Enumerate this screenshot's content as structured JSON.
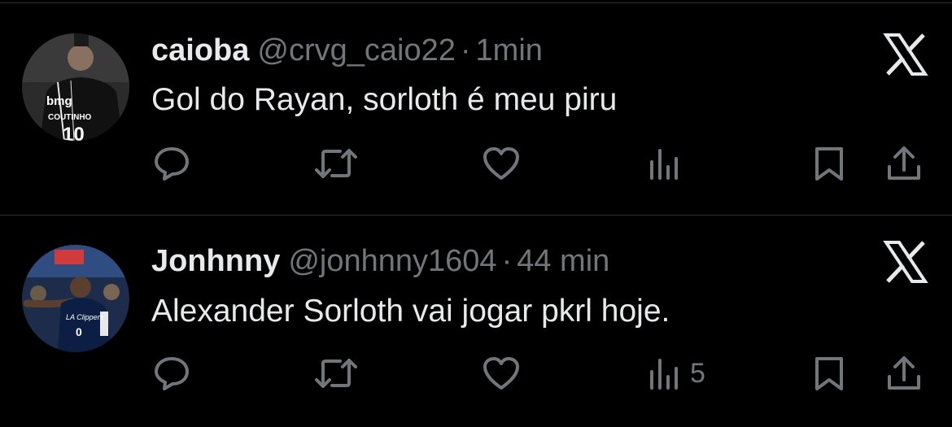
{
  "tweets": [
    {
      "name": "caioba",
      "handle": "@crvg_caio22",
      "separator": "·",
      "time": "1min",
      "text": "Gol do Rayan, sorloth é meu piru",
      "avatar": {
        "sponsor": "bmg",
        "player": "COUTINHO",
        "number": "10"
      },
      "views": ""
    },
    {
      "name": "Jonhnny",
      "handle": "@jonhnny1604",
      "separator": "·",
      "time": "44 min",
      "text": "Alexander Sorloth vai jogar pkrl hoje.",
      "avatar": {
        "jersey_text": "LA Clippers",
        "number": "0"
      },
      "views": "5"
    }
  ],
  "icons": {
    "reply": "reply-icon",
    "retweet": "retweet-icon",
    "like": "heart-icon",
    "views": "views-icon",
    "bookmark": "bookmark-icon",
    "share": "share-icon",
    "source": "x-logo-icon"
  },
  "colors": {
    "background": "#000000",
    "text_primary": "#e7e9ea",
    "text_secondary": "#71767b",
    "divider": "#2f3336"
  }
}
